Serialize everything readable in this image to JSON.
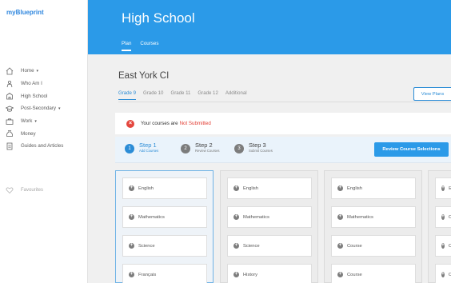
{
  "app": {
    "logo": "myBlueprint"
  },
  "sidebar": {
    "items": [
      {
        "label": "Home",
        "icon": "home-icon",
        "caret": "▾"
      },
      {
        "label": "Who Am I",
        "icon": "person-icon",
        "caret": ""
      },
      {
        "label": "High School",
        "icon": "building-icon",
        "caret": ""
      },
      {
        "label": "Post-Secondary",
        "icon": "graduation-cap-icon",
        "caret": "▾"
      },
      {
        "label": "Work",
        "icon": "briefcase-icon",
        "caret": "▾"
      },
      {
        "label": "Money",
        "icon": "money-bag-icon",
        "caret": ""
      },
      {
        "label": "Guides and Articles",
        "icon": "document-icon",
        "caret": ""
      }
    ],
    "favourites": "Favourites"
  },
  "header": {
    "title": "High School",
    "tabs": [
      {
        "label": "Plan",
        "active": true
      },
      {
        "label": "Courses",
        "active": false
      }
    ]
  },
  "school": {
    "name": "East York CI",
    "grades": [
      {
        "label": "Grade 9",
        "active": true
      },
      {
        "label": "Grade 10",
        "active": false
      },
      {
        "label": "Grade 11",
        "active": false
      },
      {
        "label": "Grade 12",
        "active": false
      },
      {
        "label": "Additional",
        "active": false
      }
    ],
    "view_plans": "View Plans"
  },
  "status": {
    "prefix": "Your courses are",
    "value": "Not Submitted"
  },
  "steps": [
    {
      "number": "1",
      "title": "Step 1",
      "subtitle": "Add Courses",
      "active": true
    },
    {
      "number": "2",
      "title": "Step 2",
      "subtitle": "Review Courses",
      "active": false
    },
    {
      "number": "3",
      "title": "Step 3",
      "subtitle": "Submit Courses",
      "active": false
    }
  ],
  "review_button": "Review Course Selections",
  "columns": [
    {
      "selected": true,
      "cards": [
        "English",
        "Mathematics",
        "Science",
        "Français"
      ]
    },
    {
      "selected": false,
      "cards": [
        "English",
        "Mathematics",
        "Science",
        "History"
      ]
    },
    {
      "selected": false,
      "cards": [
        "English",
        "Mathematics",
        "Course",
        "Course"
      ]
    },
    {
      "selected": false,
      "cards": [
        "E",
        "C",
        "C",
        "C"
      ]
    }
  ],
  "colors": {
    "header_blue": "#2b9ae8",
    "accent_blue": "#2b8cd6",
    "error_red": "#e23c32"
  }
}
